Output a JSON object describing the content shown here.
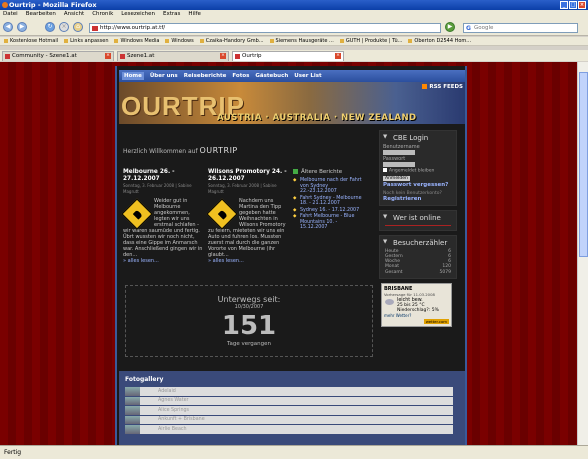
{
  "window": {
    "title": "Ourtrip - Mozilla Firefox"
  },
  "menu": [
    "Datei",
    "Bearbeiten",
    "Ansicht",
    "Chronik",
    "Lesezeichen",
    "Extras",
    "Hilfe"
  ],
  "address": {
    "url": "http://www.ourtrip.at.tf/"
  },
  "search": {
    "placeholder": "Google"
  },
  "bookmarks": [
    "Kostenlose Hotmail",
    "Links anpassen",
    "Windows Media",
    "Windows",
    "Czaika-Handory Gmb...",
    "Siemens Hausgeräte ...",
    "GUTH | Produkte | Tü...",
    "Oberton D2544 Hom..."
  ],
  "tabs": [
    "Community - Szene1.at",
    "Szene1.at",
    "Ourtrip"
  ],
  "status": "Fertig",
  "site": {
    "nav": [
      "Home",
      "Über uns",
      "Reiseberichte",
      "Fotos",
      "Gästebuch",
      "User List"
    ],
    "logo": "OURTRIP",
    "countries": "AUSTRIA · AUSTRALIA · NEW ZEALAND",
    "rss": "RSS FEEDS",
    "greeting_prefix": "Herzlich Willkommen auf",
    "greeting_brand": "OURTRIP",
    "posts": [
      {
        "title": "Melbourne 26. - 27.12.2007",
        "meta": "Sonntag, 3. Februar 2008 | Sabine Magrutt",
        "text": "Weider gut in Melbourne angekommen, legten wir uns erstmal schlafen - wir waren saumüde und fertig. Übrt wussten wir noch nicht, dass eine Gippe im Anmarsch war. Anschließend gingen wir in den...",
        "more": "» alles lesen..."
      },
      {
        "title": "Wilsons Promotory 24. - 26.12.2007",
        "meta": "Sonntag, 3. Februar 2008 | Sabine Magrutt",
        "text": "Nachdem uns Martina den Tipp gegeben hatte Weihnachten in Wilsons Promotory zu feiern, mieteten wir uns ein Auto und fuhren los. Mussten zuerst mal durch die ganzen Vororte von Melbourne (ihr glaubt...",
        "more": "» alles lesen..."
      }
    ],
    "older": {
      "heading": "Ältere Berichte",
      "items": [
        "Melbourne nach der Fahrt von Sydney 22.-23.12.2007",
        "Fahrt Sydney - Melbourne 18. - 21.12.2007",
        "Sydney 16. - 17.12.2007",
        "Fahrt Melbourne - Blue Mountains 10. - 15.12.2007"
      ]
    },
    "counter": {
      "title": "Unterwegs seit:",
      "date": "10/30/2007",
      "days": "151",
      "unit": "Tage vergangen"
    },
    "login": {
      "title": "CBE Login",
      "user_label": "Benutzername",
      "pass_label": "Passwort",
      "remember": "Angemeldet bleiben",
      "button": "Anmelden",
      "forgot": "Passwort vergessen?",
      "no_account": "Noch kein Benutzerkonto?",
      "register": "Registrieren"
    },
    "online": {
      "title": "Wer ist online"
    },
    "stats": {
      "title": "Besucherzähler",
      "rows": [
        {
          "label": "Heute",
          "value": "6"
        },
        {
          "label": "Gestern",
          "value": "6"
        },
        {
          "label": "Woche",
          "value": "6"
        },
        {
          "label": "Monat",
          "value": "120"
        },
        {
          "label": "Gesamt",
          "value": "5079"
        }
      ]
    },
    "weather": {
      "city": "BRISBANE",
      "forecast": "Vorhersage für 11.03.2008",
      "condition": "leicht bew.",
      "temp": "25 bis 25 °C",
      "rain": "Niederschlag?: 5%",
      "more": "mehr Wetter?",
      "footer": "wetter.com"
    },
    "gallery": {
      "title": "Fotogallery",
      "rows": [
        "Adelaid",
        "Agnes Water",
        "Alice Springs",
        "Ankunft + Brisbane",
        "Airlie Beach"
      ]
    }
  }
}
